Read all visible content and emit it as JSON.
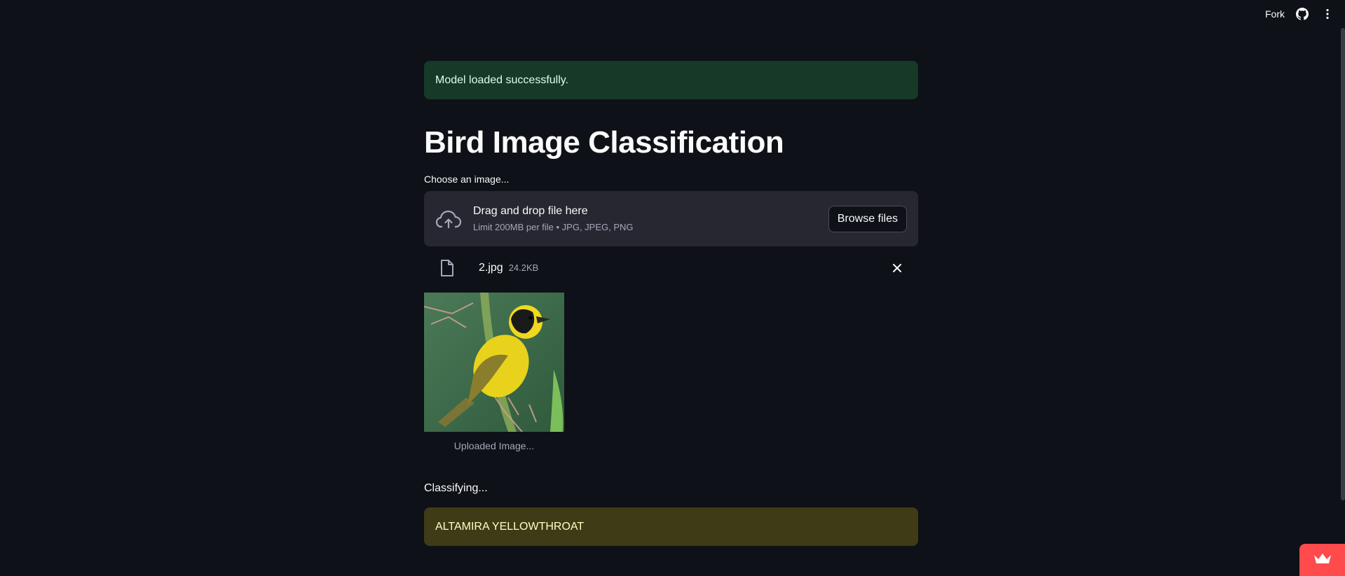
{
  "topbar": {
    "fork_label": "Fork",
    "github_icon": "github-icon",
    "menu_icon": "vertical-dots-icon"
  },
  "alerts": {
    "success_text": "Model loaded successfully.",
    "result_text": "ALTAMIRA YELLOWTHROAT"
  },
  "page": {
    "title": "Bird Image Classification"
  },
  "uploader": {
    "label": "Choose an image...",
    "drop_title": "Drag and drop file here",
    "drop_sub": "Limit 200MB per file • JPG, JPEG, PNG",
    "browse_label": "Browse files",
    "upload_icon": "cloud-upload-icon"
  },
  "file": {
    "name": "2.jpg",
    "size": "24.2KB",
    "file_icon": "file-icon",
    "remove_icon": "close-icon"
  },
  "image": {
    "caption": "Uploaded Image..."
  },
  "status": {
    "text": "Classifying..."
  },
  "colors": {
    "background": "#0e1117",
    "success_bg": "#173928",
    "warning_bg": "#3e3b16",
    "dropzone_bg": "#262730",
    "deploy_red": "#ff4b4b"
  }
}
